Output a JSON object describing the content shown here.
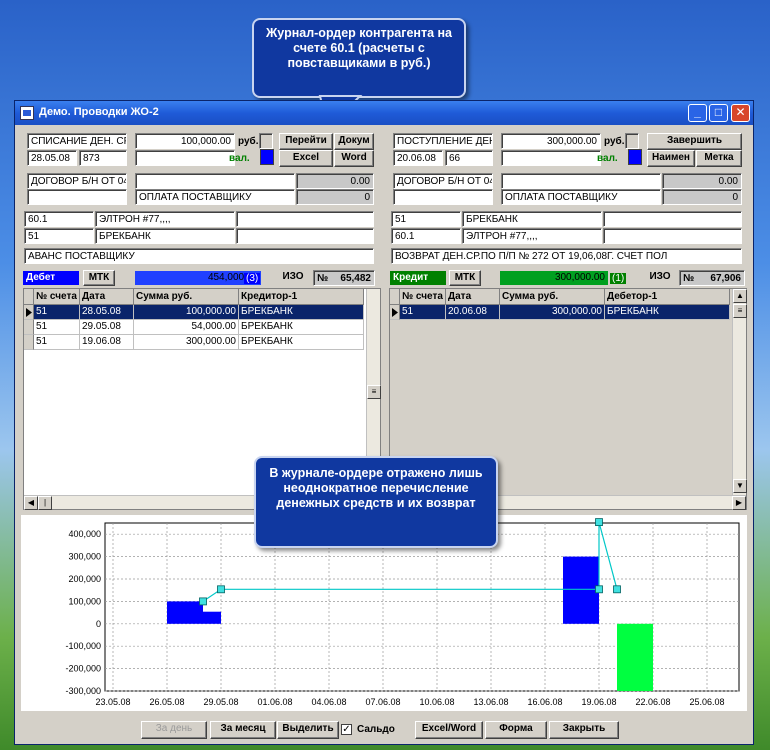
{
  "window": {
    "title": "Демо. Проводки ЖО-2"
  },
  "callouts": {
    "top": "Журнал-ордер контрагента на счете 60.1 (расчеты с повставщиками в руб.)",
    "middle": "В журнале-ордере отражено лишь неоднократное перечисление денежных средств и их возврат"
  },
  "left": {
    "doc_type": "СПИСАНИЕ ДЕН. СР",
    "date": "28.05.08",
    "number": "873",
    "amount": "100,000.00",
    "currency_label": "руб.",
    "val_label": "вал.",
    "contract": "ДОГОВОР Б/Н ОТ 04",
    "field_right1": "0.00",
    "purpose": "ОПЛАТА ПОСТАВЩИКУ",
    "field_right2": "0",
    "acc1": "60.1",
    "acc1_name": "ЭЛТРОН #77,,,,",
    "acc2": "51",
    "acc2_name": "БРЕКБАНК",
    "description": "АВАНС ПОСТАВЩИКУ",
    "buttons": {
      "goto": "Перейти",
      "doc": "Докум",
      "excel": "Excel",
      "word": "Word"
    },
    "tag": "Дебет",
    "mtk": "МТК",
    "total": "454,000.00",
    "count": "(3)",
    "izo": "ИЗО",
    "no_sign": "№",
    "num_value": "65,482",
    "columns": [
      "№ счета",
      "Дата",
      "Сумма руб.",
      "Кредитор-1"
    ],
    "rows": [
      [
        "51",
        "28.05.08",
        "100,000.00",
        "БРЕКБАНК"
      ],
      [
        "51",
        "29.05.08",
        "54,000.00",
        "БРЕКБАНК"
      ],
      [
        "51",
        "19.06.08",
        "300,000.00",
        "БРЕКБАНК"
      ]
    ]
  },
  "right": {
    "doc_type": "ПОСТУПЛЕНИЕ ДЕН",
    "date": "20.06.08",
    "number": "66",
    "amount": "300,000.00",
    "currency_label": "руб.",
    "val_label": "вал.",
    "contract": "ДОГОВОР Б/Н ОТ 04",
    "field_right1": "0.00",
    "purpose": "ОПЛАТА ПОСТАВЩИКУ",
    "field_right2": "0",
    "acc1": "51",
    "acc1_name": "БРЕКБАНК",
    "acc2": "60.1",
    "acc2_name": "ЭЛТРОН #77,,,,",
    "description": "ВОЗВРАТ ДЕН.СР.ПО П/П № 272 ОТ 19,06,08Г. СЧЕТ ПОЛ",
    "buttons": {
      "finish": "Завершить",
      "name": "Наимен",
      "mark": "Метка"
    },
    "tag": "Кредит",
    "mtk": "МТК",
    "total": "300,000.00",
    "count": "(1)",
    "izo": "ИЗО",
    "no_sign": "№",
    "num_value": "67,906",
    "columns": [
      "№ счета",
      "Дата",
      "Сумма руб.",
      "Дебетор-1"
    ],
    "rows": [
      [
        "51",
        "20.06.08",
        "300,000.00",
        "БРЕКБАНК"
      ]
    ]
  },
  "bottom_buttons": {
    "day": "За день",
    "month": "За месяц",
    "select": "Выделить",
    "saldo": "Сальдо",
    "saldo_checked": true,
    "excel_word": "Excel/Word",
    "form": "Форма",
    "close": "Закрыть"
  },
  "colors": {
    "debit_bar": "#0000ff",
    "credit_bar": "#00ff40",
    "line": "#00c8c8",
    "selection": "#0a246a"
  },
  "chart_data": {
    "type": "bar",
    "x_ticks": [
      "23.05.08",
      "26.05.08",
      "29.05.08",
      "01.06.08",
      "04.06.08",
      "07.06.08",
      "10.06.08",
      "13.06.08",
      "16.06.08",
      "19.06.08",
      "22.06.08",
      "25.06.08"
    ],
    "y_ticks": [
      "400,000",
      "300,000",
      "200,000",
      "100,000",
      "0",
      "-100,000",
      "-200,000",
      "-300,000"
    ],
    "ylim": [
      -300000,
      450000
    ],
    "grid": true,
    "bars": [
      {
        "start": "26.05.08",
        "end": "28.05.08",
        "value": 100000,
        "series": "debit"
      },
      {
        "start": "28.05.08",
        "end": "29.05.08",
        "value": 54000,
        "series": "debit"
      },
      {
        "start": "17.06.08",
        "end": "19.06.08",
        "value": 300000,
        "series": "debit"
      },
      {
        "start": "20.06.08",
        "end": "22.06.08",
        "value": -300000,
        "series": "credit"
      }
    ],
    "balance_line": [
      {
        "x": "28.05.08",
        "y": 100000
      },
      {
        "x": "29.05.08",
        "y": 154000
      },
      {
        "x": "19.06.08",
        "y": 154000
      },
      {
        "x": "19.06.08",
        "y": 454000
      },
      {
        "x": "20.06.08",
        "y": 154000
      }
    ]
  }
}
